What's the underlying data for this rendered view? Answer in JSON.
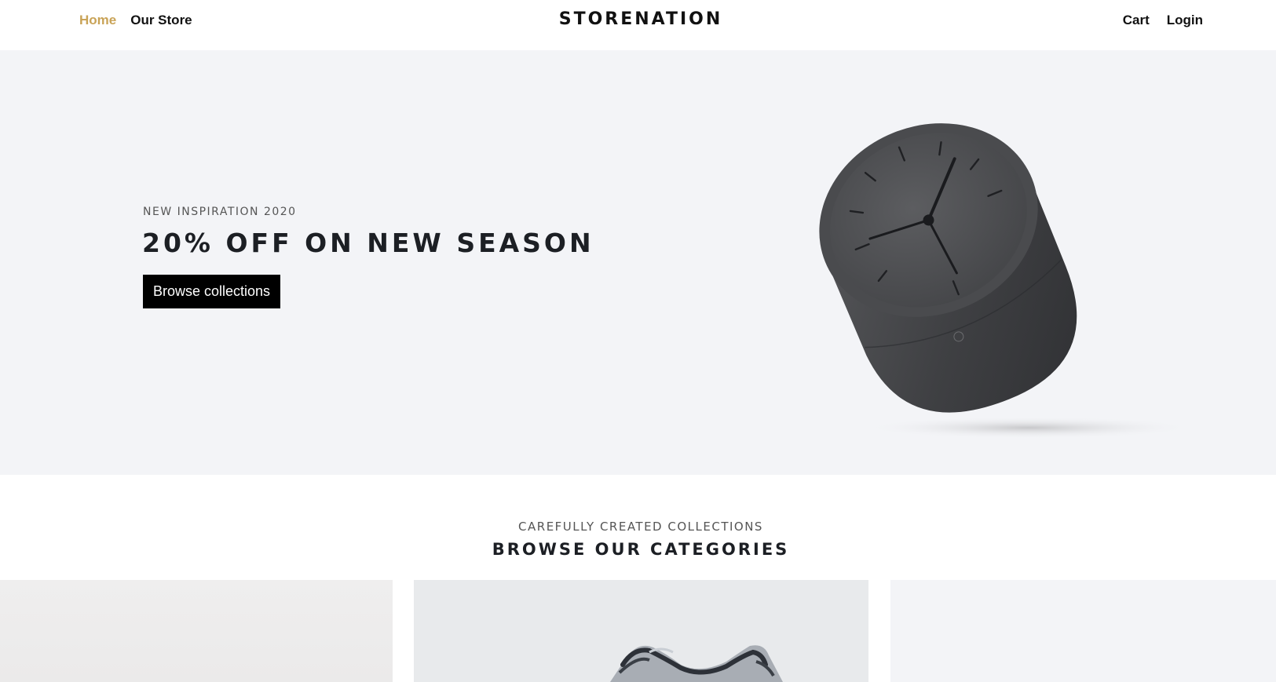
{
  "nav": {
    "left_links": [
      {
        "label": "Home",
        "active": true
      },
      {
        "label": "Our Store",
        "active": false
      }
    ],
    "brand": "STORENATION",
    "right_links": [
      {
        "label": "Cart"
      },
      {
        "label": "Login"
      }
    ]
  },
  "hero": {
    "eyebrow": "NEW INSPIRATION 2020",
    "title": "20% OFF ON NEW SEASON",
    "button_label": "Browse collections",
    "image": "desk-clock-image"
  },
  "categories": {
    "eyebrow": "CAREFULLY CREATED COLLECTIONS",
    "title": "BROWSE OUR CATEGORIES",
    "cards": [
      {
        "image": "category-image"
      },
      {
        "image": "sneaker-image"
      },
      {
        "image": "category-image"
      }
    ]
  },
  "colors": {
    "accent": "#c9a357",
    "hero_background": "#f3f4f7",
    "button_background": "#000000",
    "text_dark": "#1c1f24"
  }
}
